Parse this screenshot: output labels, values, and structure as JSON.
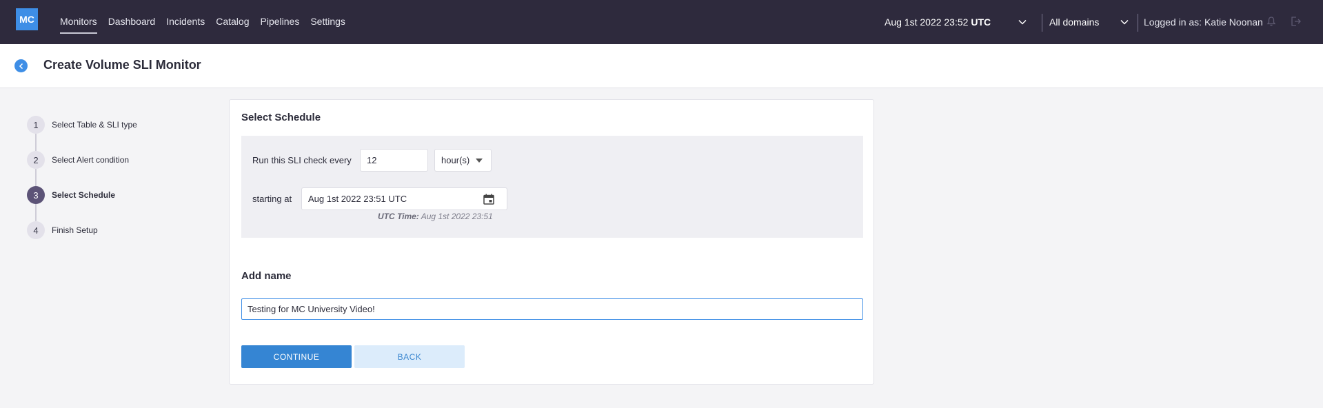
{
  "app": {
    "logo": "MC",
    "nav": [
      "Monitors",
      "Dashboard",
      "Incidents",
      "Catalog",
      "Pipelines",
      "Settings"
    ],
    "time_display": "Aug 1st 2022 23:52",
    "time_zone": "UTC",
    "domain_select": "All domains",
    "user_label": "Logged in as: Katie Noonan"
  },
  "page": {
    "title": "Create Volume SLI Monitor"
  },
  "steps": [
    {
      "num": "1",
      "label": "Select Table & SLI type",
      "active": false
    },
    {
      "num": "2",
      "label": "Select Alert condition",
      "active": false
    },
    {
      "num": "3",
      "label": "Select Schedule",
      "active": true
    },
    {
      "num": "4",
      "label": "Finish Setup",
      "active": false
    }
  ],
  "schedule": {
    "title": "Select Schedule",
    "run_label": "Run this SLI check every",
    "interval_value": "12",
    "unit_value": "hour(s)",
    "starting_label": "starting at",
    "start_value": "Aug 1st 2022 23:51 UTC",
    "utc_prefix": "UTC Time:",
    "utc_value": "Aug 1st 2022 23:51"
  },
  "name_section": {
    "title": "Add name",
    "value": "Testing for MC University Video!"
  },
  "buttons": {
    "continue": "CONTINUE",
    "back": "BACK"
  },
  "colors": {
    "topbar": "#2e2a3d",
    "accent": "#3e8ee6",
    "active_step": "#5c5377"
  }
}
